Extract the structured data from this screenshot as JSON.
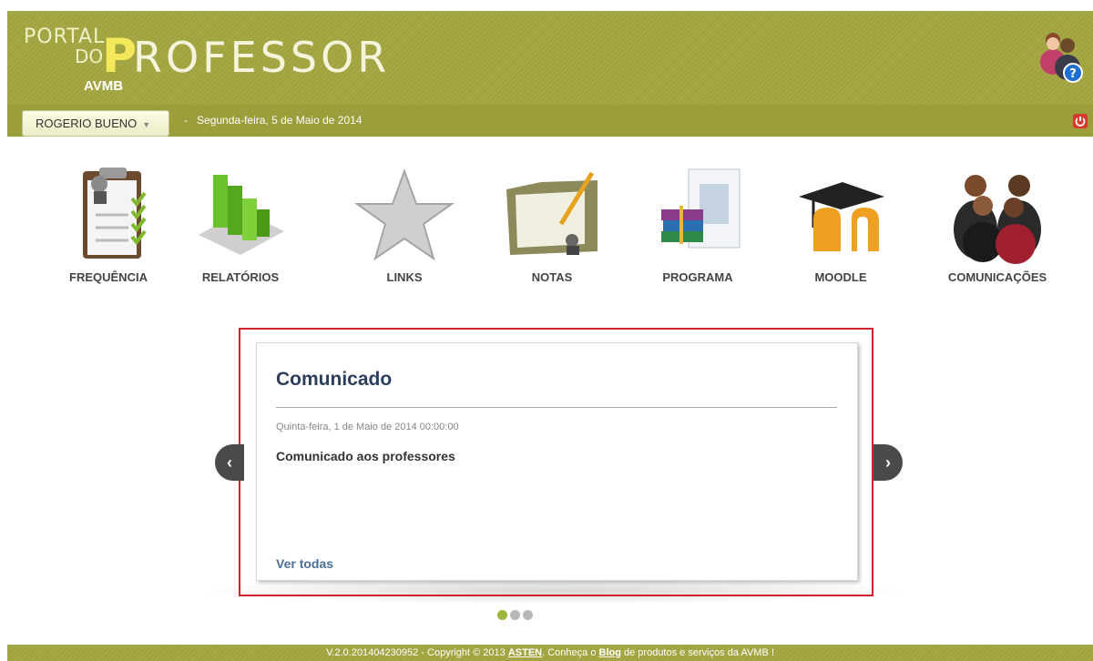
{
  "header": {
    "logo_line1": "PORTAL",
    "logo_line2": "DO",
    "logo_p": "P",
    "logo_rest": "ROFESSOR",
    "logo_sub": "AVMB"
  },
  "userbar": {
    "user_name": "ROGERIO BUENO",
    "separator": "-",
    "date": "Segunda-feira, 5 de Maio de 2014"
  },
  "menu": [
    {
      "label": "FREQUÊNCIA",
      "icon": "attendance-clipboard-icon"
    },
    {
      "label": "RELATÓRIOS",
      "icon": "reports-bars-icon"
    },
    {
      "label": "LINKS",
      "icon": "star-icon"
    },
    {
      "label": "NOTAS",
      "icon": "grades-folder-icon"
    },
    {
      "label": "PROGRAMA",
      "icon": "books-program-icon"
    },
    {
      "label": "MOODLE",
      "icon": "moodle-icon"
    },
    {
      "label": "COMUNICAÇÕES",
      "icon": "people-communications-icon"
    }
  ],
  "notice": {
    "title": "Comunicado",
    "date": "Quinta-feira, 1 de Maio de 2014 00:00:00",
    "body": "Comunicado aos professores",
    "link": "Ver todas",
    "prev_arrow": "‹",
    "next_arrow": "›"
  },
  "footer": {
    "prefix": "V.2.0.201404230952 - Copyright © 2013 ",
    "asten": "ASTEN",
    "mid": ". Conheça o ",
    "blog": "Blog",
    "suffix": " de produtos e serviços da AVMB !"
  },
  "colors": {
    "header_green": "#9fa23f",
    "title_blue": "#2b3e5c",
    "highlight_red": "#d0222b",
    "active_dot": "#9bb63a"
  }
}
